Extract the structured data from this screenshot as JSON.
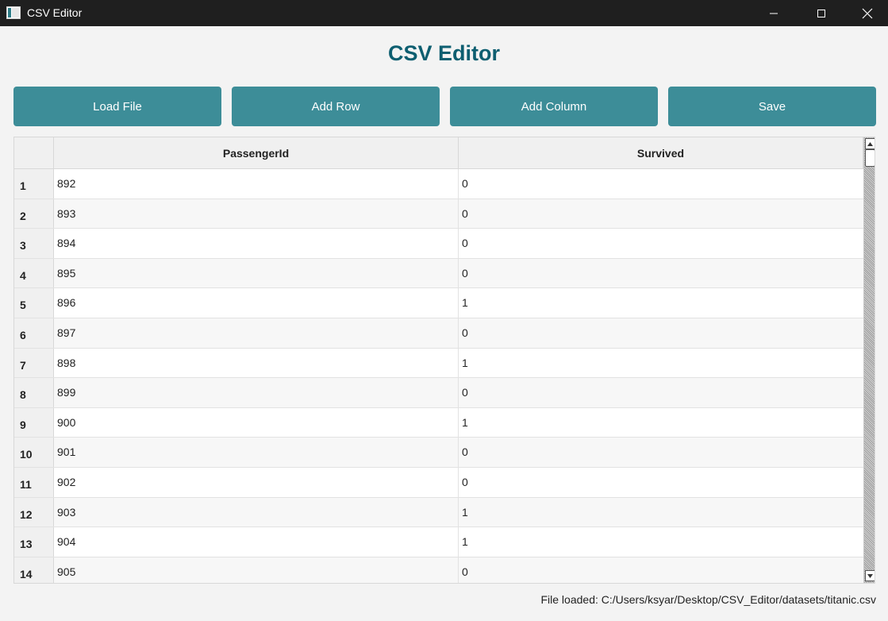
{
  "window": {
    "title": "CSV Editor"
  },
  "heading": "CSV Editor",
  "toolbar": {
    "load_label": "Load File",
    "add_row_label": "Add Row",
    "add_column_label": "Add Column",
    "save_label": "Save"
  },
  "table": {
    "columns": [
      "PassengerId",
      "Survived"
    ],
    "rows": [
      [
        "1",
        "892",
        "0"
      ],
      [
        "2",
        "893",
        "0"
      ],
      [
        "3",
        "894",
        "0"
      ],
      [
        "4",
        "895",
        "0"
      ],
      [
        "5",
        "896",
        "1"
      ],
      [
        "6",
        "897",
        "0"
      ],
      [
        "7",
        "898",
        "1"
      ],
      [
        "8",
        "899",
        "0"
      ],
      [
        "9",
        "900",
        "1"
      ],
      [
        "10",
        "901",
        "0"
      ],
      [
        "11",
        "902",
        "0"
      ],
      [
        "12",
        "903",
        "1"
      ],
      [
        "13",
        "904",
        "1"
      ],
      [
        "14",
        "905",
        "0"
      ]
    ]
  },
  "status": "File loaded: C:/Users/ksyar/Desktop/CSV_Editor/datasets/titanic.csv",
  "colors": {
    "accent": "#3d8d98",
    "heading": "#0d5e70",
    "titlebar": "#1f1f1f"
  }
}
